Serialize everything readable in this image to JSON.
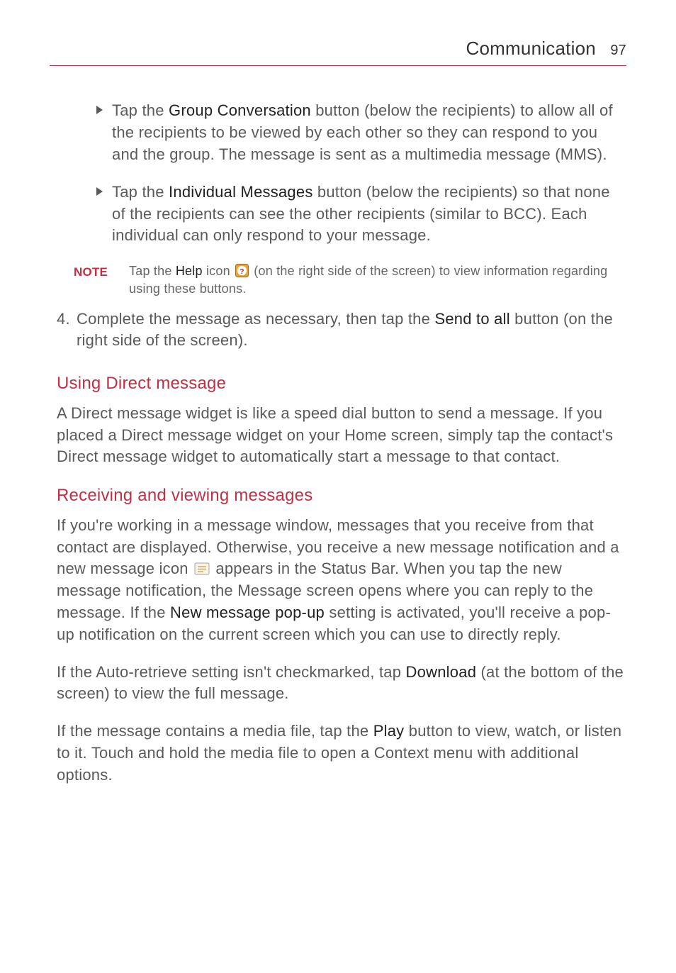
{
  "header": {
    "title": "Communication",
    "page": "97"
  },
  "bullets": {
    "b1_pre": "Tap the ",
    "b1_bold": "Group Conversation",
    "b1_post": " button (below the recipients) to allow all of the recipients to be viewed by each other so they can respond to you and the group. The message is sent as a multimedia message (MMS).",
    "b2_pre": "Tap the ",
    "b2_bold": "Individual Messages",
    "b2_post": " button (below the recipients) so that none of the recipients can see the other recipients (similar to BCC). Each individual can only respond to your message."
  },
  "note": {
    "label": "NOTE",
    "pre": "Tap the ",
    "bold": "Help",
    "mid": " icon ",
    "post": " (on the right side of the screen) to view information regarding using these buttons."
  },
  "step4": {
    "num": "4.",
    "pre": "Complete the message as necessary, then tap the ",
    "bold": "Send to all",
    "post": " button (on the right side of the screen)."
  },
  "sec1": {
    "heading": "Using Direct message",
    "text": "A Direct message widget is like a speed dial button to send a message. If you placed a Direct message widget on your Home screen, simply tap the contact's Direct message widget to automatically start a message to that contact."
  },
  "sec2": {
    "heading": "Receiving and viewing messages",
    "p1_a": "If you're working in a message window, messages that you receive from that contact are displayed. Otherwise, you receive a new message notification and a new message icon ",
    "p1_b": " appears in the Status Bar. When you tap the new message notification, the Message screen opens where you can reply to the message. If the ",
    "p1_bold": "New message pop-up",
    "p1_c": " setting is activated, you'll receive a pop-up notification on the current screen which you can use to directly reply.",
    "p2_a": "If the Auto-retrieve setting isn't checkmarked, tap ",
    "p2_bold": "Download",
    "p2_b": " (at the bottom of the screen) to view the full message.",
    "p3_a": "If the message contains a media file, tap the ",
    "p3_bold": "Play",
    "p3_b": " button to view, watch, or listen to it. Touch and hold the media file to open a Context menu with additional options."
  }
}
